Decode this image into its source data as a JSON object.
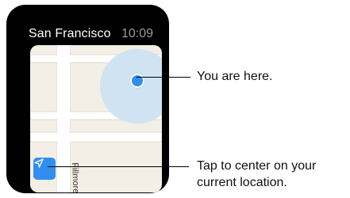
{
  "watch": {
    "location_title": "San Francisco",
    "time": "10:09"
  },
  "map": {
    "street_name": "Fillmore St"
  },
  "callouts": {
    "current_location": "You are here.",
    "center_button_line1": "Tap to center on your",
    "center_button_line2": "current location."
  },
  "icons": {
    "center_button": "location-arrow-icon"
  },
  "colors": {
    "accent": "#2f8ef0",
    "accuracy_halo": "#cfe3f2",
    "map_background": "#f3efe6",
    "road": "#ffffff"
  }
}
